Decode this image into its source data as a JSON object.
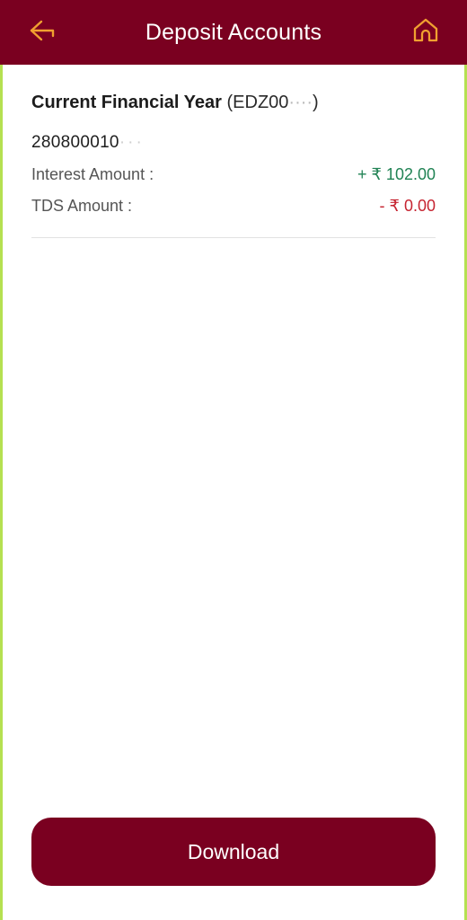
{
  "theme": {
    "header_bg": "#7a0020",
    "accent_border": "#b5e051",
    "icon_color": "#f0a030",
    "credit_color": "#218355",
    "debit_color": "#c62431",
    "page_bg": "#ffffff"
  },
  "header": {
    "title": "Deposit Accounts",
    "back_icon": "arrow-left-icon",
    "home_icon": "home-icon"
  },
  "account": {
    "period_label": "Current Financial Year",
    "scheme_code_prefix": "(EDZ00",
    "scheme_code_masked": "····",
    "scheme_code_suffix": ")",
    "account_number": "280800010",
    "account_number_masked": "···",
    "rows": [
      {
        "label": "Interest Amount :",
        "value": "+ ₹ 102.00",
        "type": "credit"
      },
      {
        "label": "TDS Amount :",
        "value": "- ₹ 0.00",
        "type": "debit"
      }
    ]
  },
  "footer": {
    "download_label": "Download"
  }
}
